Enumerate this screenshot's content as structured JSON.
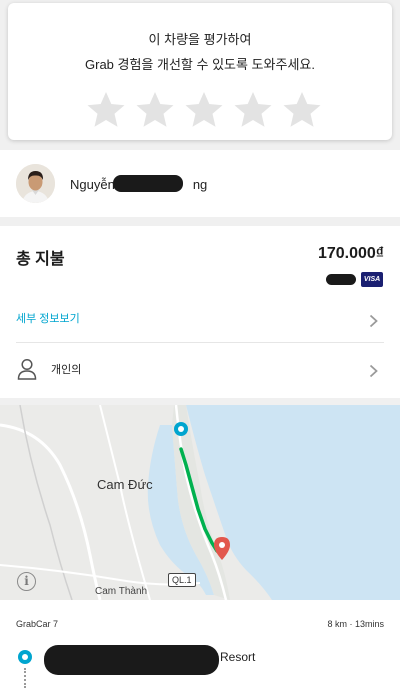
{
  "rating": {
    "line1": "이 차량을 평가하여",
    "line2": "Grab 경험을 개선할 수 있도록 도와주세요.",
    "stars_total": 5,
    "star_color": "#e3e3e3"
  },
  "driver": {
    "name_start": "Nguyễn",
    "name_end": "ng"
  },
  "payment": {
    "total_label": "총 지불",
    "total_amount": "170.000₫",
    "card_brand": "VISA",
    "details_link": "세부 정보보기",
    "personal_label": "개인의"
  },
  "map": {
    "city_label": "Cam Đức",
    "area_label": "Cam Thành",
    "road_badge": "QL.1",
    "info_icon": "i",
    "water_color": "#cde4f3",
    "route_color": "#00b14f"
  },
  "trip": {
    "vehicle_type": "GrabCar 7",
    "meta": "8 km · 13mins",
    "pickup_suffix": "Resort"
  },
  "colors": {
    "accent": "#00a5cf",
    "background": "#f0f0f0"
  }
}
